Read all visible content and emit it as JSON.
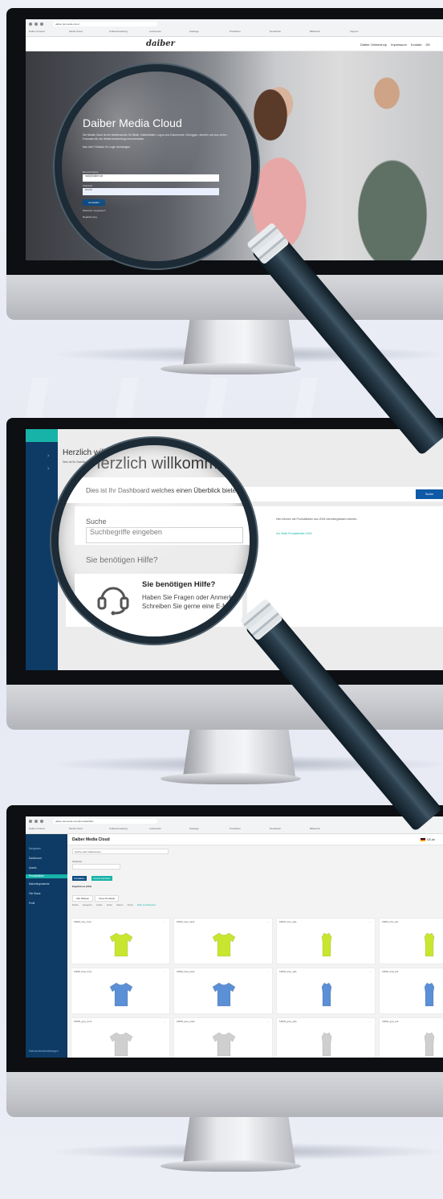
{
  "screen1": {
    "tabs_url": "daiber.de/media-cloud",
    "bookmarks": [
      "Daiber Intranet",
      "Media Cloud",
      "Artikelverwaltung",
      "Lieferanten",
      "Kataloge",
      "Preislisten",
      "Newsletter",
      "Bildarchiv",
      "Support"
    ],
    "logo": "daiber",
    "nav": [
      "Daiber Onlineshop",
      "Impressum",
      "Kontakt",
      "DE"
    ],
    "hero": {
      "title": "Daiber Media Cloud",
      "description": "Die Media Cloud ist ein Medienarchiv für Bilder, Datenblätter, Logos und Dokumente. Einloggen, abrufen und aus vielen Formaten für die Weiterverarbeitung herunterladen.",
      "hint": "Neu hier? Einfach Ihr Login beantragen."
    },
    "form": {
      "email_label": "Benutzername",
      "email_value": "mail@daiber.de",
      "password_label": "Passwort",
      "password_value": "••••••••",
      "login_label": "Anmelden",
      "forgot_label": "Passwort vergessen?",
      "register_label": "Registrierung"
    }
  },
  "screen2": {
    "title_small": "Herzlich willkommen",
    "title_zoom": "Herzlich willkommen",
    "subtitle": "Dies ist Ihr Dashboard welches einen Überblick bietet",
    "search_label": "Suche",
    "search_placeholder": "Suchbegriffe eingeben",
    "search_button": "Suche",
    "help_question": "Sie benötigen Hilfe?",
    "help_title": "Sie benötigen Hilfe?",
    "help_body": "Haben Sie Fragen oder Anmerkungen? Schreiben Sie gerne eine E-Mail.",
    "right_text": "Hier können die Produktbilder aus 2024 heruntergeladen werden.",
    "right_link": "Zur Seite Produktbilder 2024"
  },
  "screen3": {
    "url": "daiber.de/media-cloud/produktbilder",
    "bookmarks": [
      "Daiber Intranet",
      "Media Cloud",
      "Artikelverwaltung",
      "Lieferanten",
      "Kataloge",
      "Preislisten",
      "Newsletter",
      "Bildarchiv"
    ],
    "sidebar": {
      "section": "Navigation",
      "items": [
        "Dashboard",
        "Assets",
        "Produktbilder",
        "Marketingmaterial",
        "File Share",
        "Profil"
      ],
      "footer": "Datenschutzeinstellungen"
    },
    "title": "Daiber Media Cloud",
    "lang": "DE-de",
    "search_placeholder": "Suche nach Dateinamen",
    "sort_label": "Sortieren",
    "btn_primary": "Auswählen",
    "btn_secondary": "Ansicht wechseln",
    "results": "Ergebnisse (210)",
    "tabs": [
      "Alle Dateien",
      "Neue Produkte"
    ],
    "filters": [
      "Marke",
      "Kategorie",
      "Größe",
      "Farbe",
      "Saison",
      "Druck",
      "Filter zurücksetzen"
    ],
    "tiles": [
      {
        "name": "K0001_lime_front",
        "color": "#c8e62f",
        "shape": "tee"
      },
      {
        "name": "K0001_lime_back",
        "color": "#c8e62f",
        "shape": "tee"
      },
      {
        "name": "K0001_lime_side",
        "color": "#c8e62f",
        "shape": "side"
      },
      {
        "name": "K0001_lime_left",
        "color": "#c8e62f",
        "shape": "side"
      },
      {
        "name": "K0002_blue_front",
        "color": "#5b8fd6",
        "shape": "tee"
      },
      {
        "name": "K0002_blue_back",
        "color": "#5b8fd6",
        "shape": "tee"
      },
      {
        "name": "K0002_blue_side",
        "color": "#5b8fd6",
        "shape": "side"
      },
      {
        "name": "K0002_blue_left",
        "color": "#5b8fd6",
        "shape": "side"
      },
      {
        "name": "K0003_grey_front",
        "color": "#cfcfcf",
        "shape": "tee"
      },
      {
        "name": "K0003_grey_back",
        "color": "#cfcfcf",
        "shape": "tee"
      },
      {
        "name": "K0003_grey_side",
        "color": "#cfcfcf",
        "shape": "side"
      },
      {
        "name": "K0003_grey_left",
        "color": "#cfcfcf",
        "shape": "side"
      }
    ]
  },
  "colors": {
    "navy": "#0d3b66",
    "teal": "#17b3a8",
    "button_blue": "#0e4b82"
  }
}
